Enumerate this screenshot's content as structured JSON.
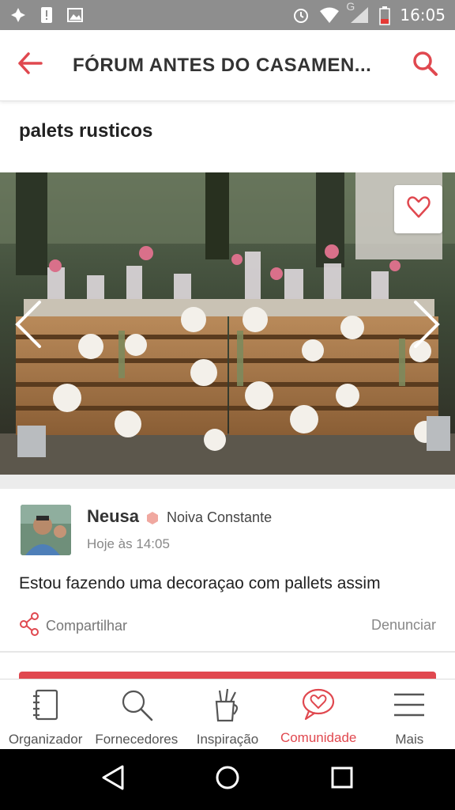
{
  "status_bar": {
    "time": "16:05",
    "network_label": "G",
    "icons": [
      "pinwheel-icon",
      "alert-icon",
      "image-icon",
      "alarm-icon",
      "wifi-icon",
      "signal-icon",
      "battery-icon"
    ]
  },
  "app_bar": {
    "title": "FÓRUM ANTES DO CASAMEN...",
    "back_icon": "back-arrow-icon",
    "search_icon": "search-icon"
  },
  "post": {
    "title": "palets rusticos",
    "author_name": "Neusa",
    "author_rank": "Noiva Constante",
    "time": "Hoje às 14:05",
    "body": "Estou fazendo uma decoraçao com pallets assim",
    "share_label": "Compartilhar",
    "report_label": "Denunciar"
  },
  "bottom_nav": {
    "items": [
      {
        "label": "Organizador",
        "icon": "notebook-icon"
      },
      {
        "label": "Fornecedores",
        "icon": "magnifier-icon"
      },
      {
        "label": "Inspiração",
        "icon": "paint-cup-icon"
      },
      {
        "label": "Comunidade",
        "icon": "heart-bubble-icon"
      },
      {
        "label": "Mais",
        "icon": "menu-icon"
      }
    ],
    "active_index": 3
  },
  "colors": {
    "accent": "#e0484f",
    "status_bar": "#8e8e8e",
    "text_dark": "#222222",
    "text_muted": "#888888",
    "badge": "#f0a8a0"
  }
}
